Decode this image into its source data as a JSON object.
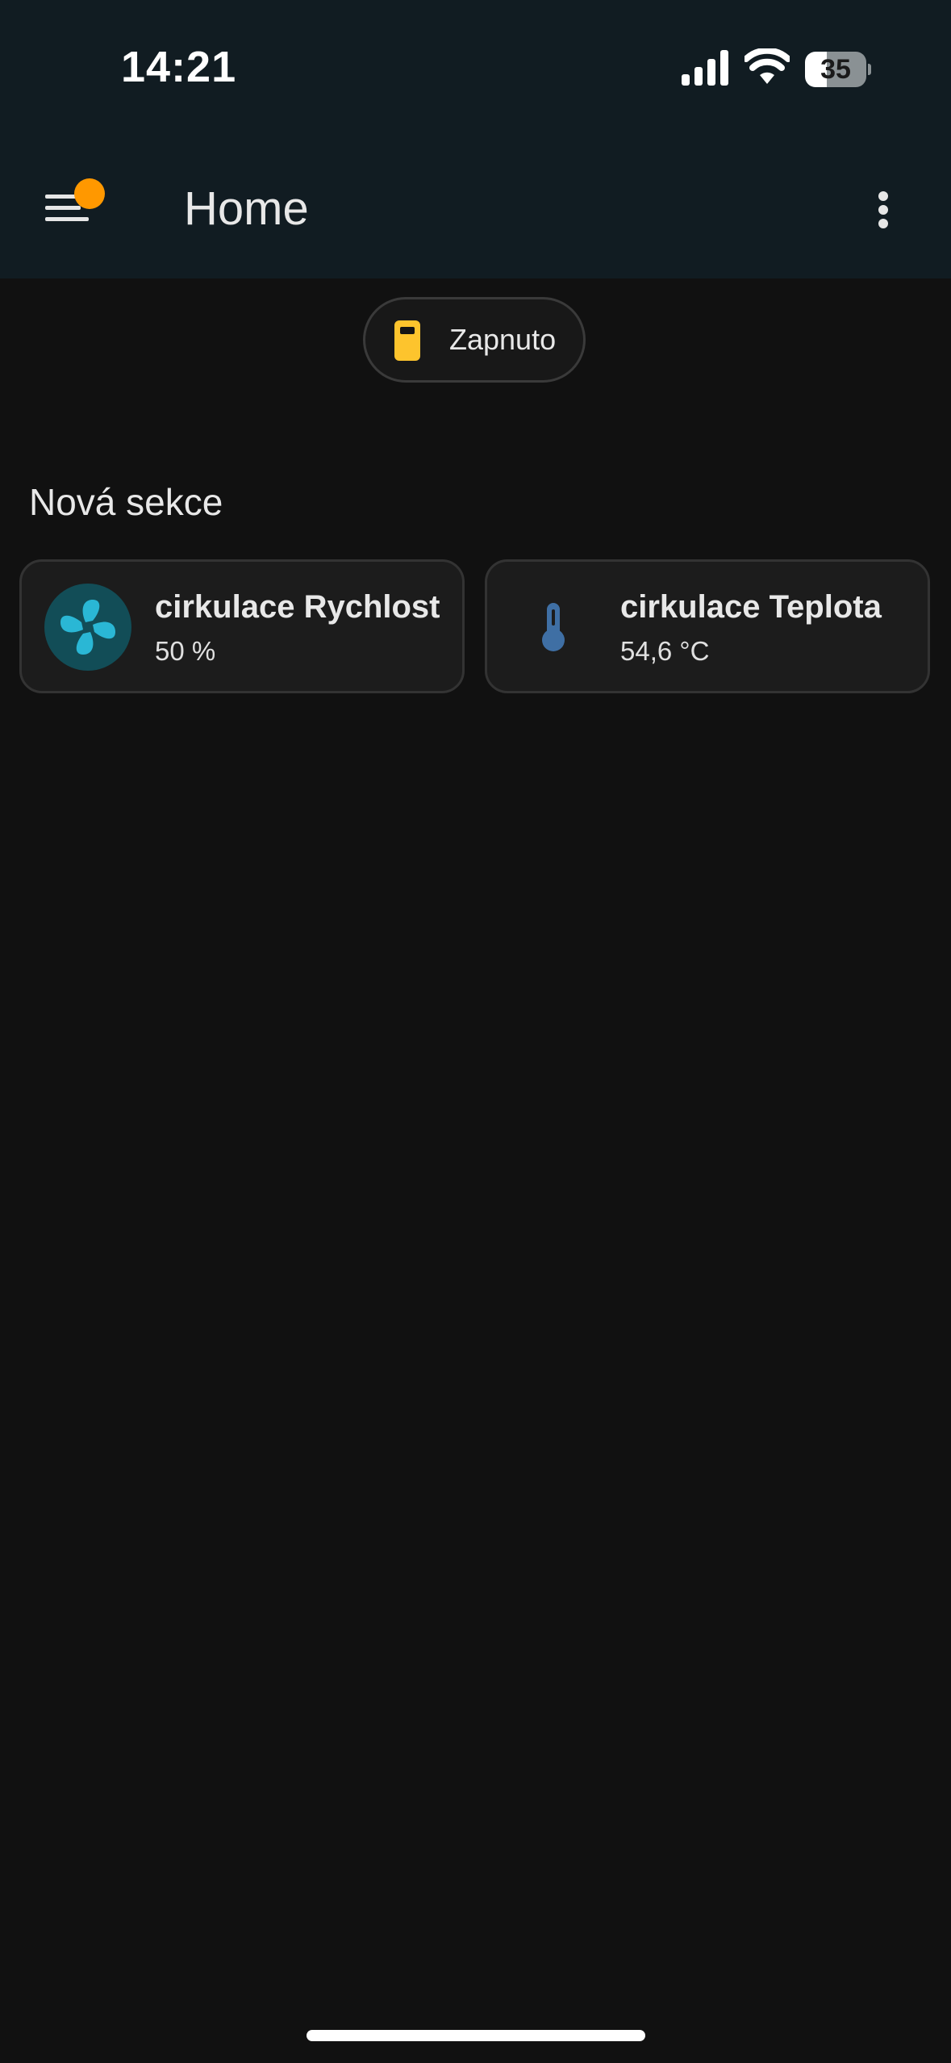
{
  "status_bar": {
    "time": "14:21",
    "battery_level": "35",
    "signal_icon": "cellular-signal-icon",
    "wifi_icon": "wifi-icon"
  },
  "app_bar": {
    "menu_icon": "menu-icon",
    "title": "Home",
    "more_icon": "more-vertical-icon"
  },
  "chip": {
    "icon": "mobile-phone-icon",
    "label": "Zapnuto",
    "icon_color": "#fdc42d"
  },
  "section": {
    "title": "Nová sekce",
    "tiles": [
      {
        "icon": "fan-icon",
        "name": "cirkulace Rychlost",
        "state": "50 %",
        "icon_color": "#2ab7d5"
      },
      {
        "icon": "thermometer-icon",
        "name": "cirkulace Teplota",
        "state": "54,6 °C",
        "icon_color": "#3f6fa4"
      }
    ]
  },
  "colors": {
    "background": "#111111",
    "app_bar": "#111c22",
    "notification_badge": "#ff9800",
    "tile_background": "#1c1c1c"
  }
}
